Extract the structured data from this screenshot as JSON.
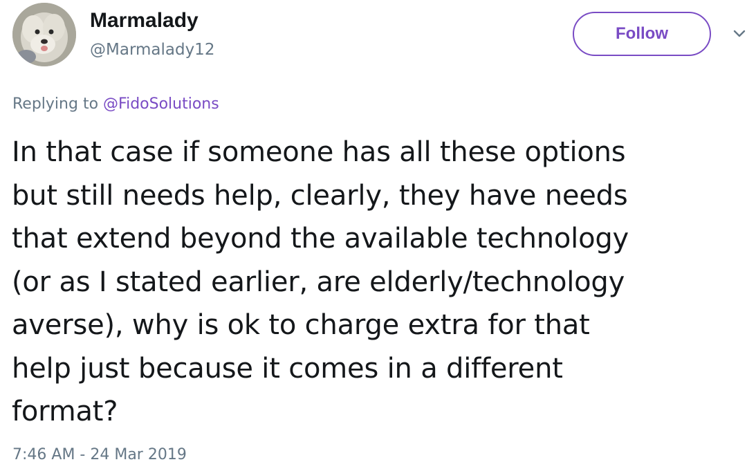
{
  "author": {
    "display_name": "Marmalady",
    "handle": "@Marmalady12",
    "avatar_icon": "dog-photo-avatar"
  },
  "follow_button": {
    "label": "Follow",
    "accent_color": "#794bc4"
  },
  "menu_icon": "chevron-down-icon",
  "reply_context": {
    "prefix": "Replying to",
    "mention": "@FidoSolutions"
  },
  "tweet": {
    "lines": [
      "In that case if someone has all these options",
      "but still needs help, clearly, they have needs",
      "that extend beyond the available technology",
      "(or as I stated earlier, are elderly/technology",
      "averse), why is ok to charge extra for that",
      "help just because it comes in a different",
      "format?"
    ]
  },
  "timestamp": "7:46 AM - 24 Mar 2019"
}
